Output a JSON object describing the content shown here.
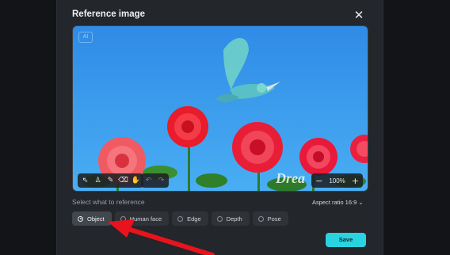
{
  "dialog": {
    "title": "Reference image",
    "close_icon": "close-icon",
    "canvas": {
      "ai_badge": "AI",
      "watermark": "Drea",
      "tools": [
        {
          "icon": "select-arrow-icon",
          "glyph": "⇖"
        },
        {
          "icon": "person-select-icon",
          "glyph": "♙"
        },
        {
          "icon": "brush-icon",
          "glyph": "✎"
        },
        {
          "icon": "eraser-icon",
          "glyph": "⌫"
        },
        {
          "icon": "hand-pan-icon",
          "glyph": "✋"
        }
      ],
      "history": [
        {
          "icon": "undo-icon",
          "glyph": "↶"
        },
        {
          "icon": "redo-icon",
          "glyph": "↷"
        }
      ],
      "zoom": {
        "minus": "−",
        "value": "100%",
        "plus": "+"
      }
    },
    "reference_label": "Select what to reference",
    "aspect_ratio": "Aspect ratio 16:9 ⌄",
    "options": [
      {
        "label": "Object",
        "selected": true
      },
      {
        "label": "Human face",
        "selected": false
      },
      {
        "label": "Edge",
        "selected": false
      },
      {
        "label": "Depth",
        "selected": false
      },
      {
        "label": "Pose",
        "selected": false
      }
    ],
    "save_label": "Save",
    "accent": "#29d3e0",
    "annotation_arrow_color": "#e8131c"
  }
}
